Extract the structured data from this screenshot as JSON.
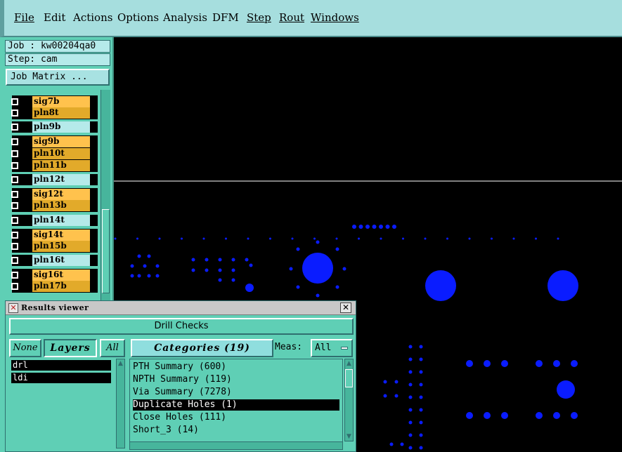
{
  "menu": [
    "File",
    "Edit",
    "Actions",
    "Options",
    "Analysis",
    "DFM",
    "Step",
    "Rout",
    "Windows"
  ],
  "job": {
    "job_text": "Job : kw00204qa0",
    "step_text": "Step: cam",
    "matrix_button": "Job Matrix ..."
  },
  "layers": [
    {
      "name": "sig7b",
      "color": "#ffc24d"
    },
    {
      "name": "pln8t",
      "color": "#e2aa2a"
    },
    {
      "name": "pln9b",
      "color": "#b5eaea"
    },
    {
      "name": "sig9b",
      "color": "#ffc24d"
    },
    {
      "name": "pln10t",
      "color": "#e2aa2a"
    },
    {
      "name": "pln11b",
      "color": "#e2aa2a"
    },
    {
      "name": "pln12t",
      "color": "#b5eaea"
    },
    {
      "name": "sig12t",
      "color": "#ffc24d"
    },
    {
      "name": "pln13b",
      "color": "#e2aa2a"
    },
    {
      "name": "pln14t",
      "color": "#b5eaea"
    },
    {
      "name": "sig14t",
      "color": "#ffc24d"
    },
    {
      "name": "pln15b",
      "color": "#e2aa2a"
    },
    {
      "name": "pln16t",
      "color": "#b5eaea"
    },
    {
      "name": "sig16t",
      "color": "#ffc24d"
    },
    {
      "name": "pln17b",
      "color": "#e2aa2a"
    }
  ],
  "results_viewer": {
    "title": "Results viewer",
    "close_label": "✕",
    "header": "Drill Checks",
    "btn_none": "None",
    "btn_layers": "Layers",
    "btn_all": "All",
    "categories_label": "Categories (19)",
    "meas_label": "Meas:",
    "meas_value": "All",
    "layer_items": [
      "drl",
      "ldi"
    ],
    "categories": [
      "PTH Summary (600)",
      "NPTH Summary (119)",
      "Via Summary (7278)",
      "Duplicate Holes (1)",
      "Close Holes (111)",
      "Short_3 (14)"
    ],
    "selected_category": "Duplicate Holes (1)"
  },
  "colors": {
    "drill_hole": "#0a1cff",
    "background": "#000000",
    "menu_bg": "#a6dede",
    "panel_bg": "#5fcfb5"
  }
}
